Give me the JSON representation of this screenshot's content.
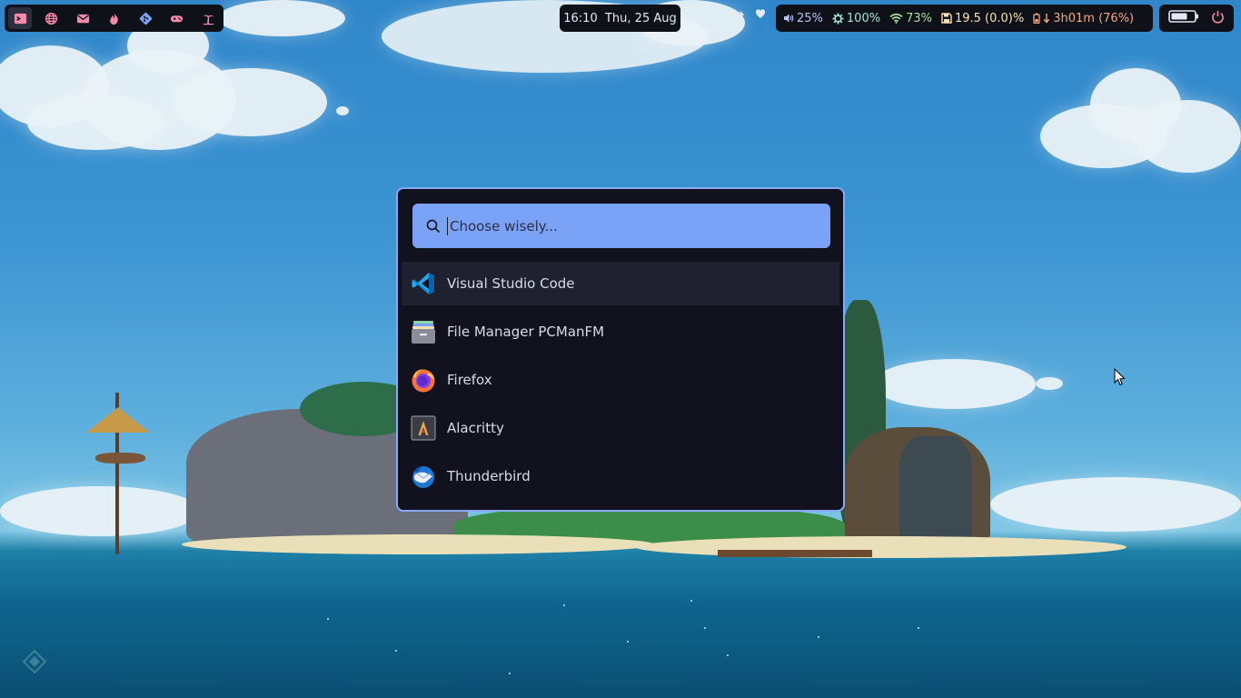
{
  "workspaces": [
    {
      "name": "terminal-icon",
      "active": true
    },
    {
      "name": "globe-icon",
      "active": false
    },
    {
      "name": "mail-icon",
      "active": false
    },
    {
      "name": "fire-icon",
      "active": false
    },
    {
      "name": "git-icon",
      "active": false
    },
    {
      "name": "gamepad-icon",
      "active": false
    },
    {
      "name": "island-icon",
      "active": false
    }
  ],
  "clock": {
    "time": "16:10",
    "date": "Thu, 25 Aug"
  },
  "stats": {
    "volume": "25%",
    "brightness": "100%",
    "wifi": "73%",
    "disk": "19.5 (0.0)%",
    "battery_time": "3h01m (76%)"
  },
  "colors": {
    "accent": "#7aa2f7",
    "workspace_icon": "#f38ba8",
    "battery_text": "#f5a97f",
    "wifi": "#a6e3a1",
    "disk": "#f9e2af"
  },
  "launcher": {
    "placeholder": "Choose wisely...",
    "items": [
      {
        "label": "Visual Studio Code",
        "icon": "vscode-icon",
        "selected": true
      },
      {
        "label": "File Manager PCManFM",
        "icon": "file-manager-icon",
        "selected": false
      },
      {
        "label": "Firefox",
        "icon": "firefox-icon",
        "selected": false
      },
      {
        "label": "Alacritty",
        "icon": "alacritty-icon",
        "selected": false
      },
      {
        "label": "Thunderbird",
        "icon": "thunderbird-icon",
        "selected": false
      }
    ]
  }
}
